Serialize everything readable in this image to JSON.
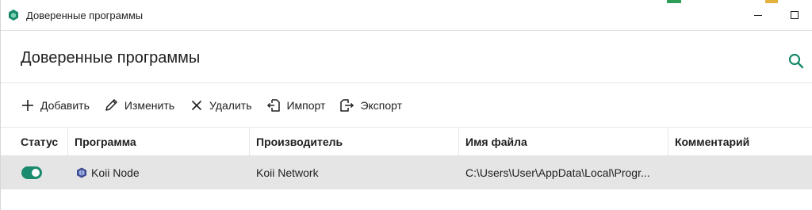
{
  "window": {
    "title": "Доверенные программы",
    "minimize": "–",
    "maximize": "☐"
  },
  "header": {
    "title": "Доверенные программы",
    "search_icon": "search-icon"
  },
  "toolbar": {
    "add_label": "Добавить",
    "edit_label": "Изменить",
    "delete_label": "Удалить",
    "import_label": "Импорт",
    "export_label": "Экспорт"
  },
  "table": {
    "columns": [
      "Статус",
      "Программа",
      "Производитель",
      "Имя файла",
      "Комментарий"
    ],
    "rows": [
      {
        "status": "on",
        "program": "Koii Node",
        "vendor": "Koii Network",
        "file": "C:\\Users\\User\\AppData\\Local\\Progr...",
        "comment": ""
      }
    ]
  },
  "colors": {
    "accent": "#1a8a6c",
    "selected_row": "#e5e5e5"
  }
}
